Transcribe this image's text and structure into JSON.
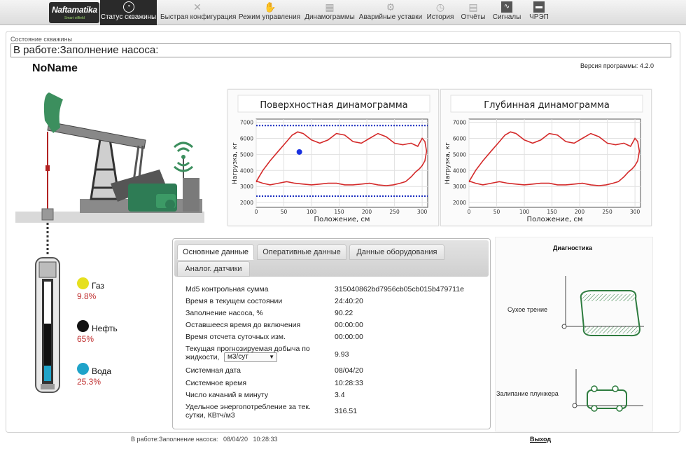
{
  "nav": {
    "logo": {
      "text": "Naftamatika",
      "subtext": "Smart oilfield"
    },
    "tabs": [
      {
        "label": "Статус скважины",
        "icon": "gauge-icon",
        "active": true
      },
      {
        "label": "Быстрая конфигурация",
        "icon": "tools-icon",
        "active": false
      },
      {
        "label": "Режим управления",
        "icon": "hand-icon",
        "active": false
      },
      {
        "label": "Динамограммы",
        "icon": "grid-icon",
        "active": false
      },
      {
        "label": "Аварийные уставки",
        "icon": "gear-icon",
        "active": false
      },
      {
        "label": "История",
        "icon": "clock-icon",
        "active": false
      },
      {
        "label": "Отчёты",
        "icon": "document-icon",
        "active": false
      },
      {
        "label": "Сигналы",
        "icon": "signal-icon",
        "active": false
      },
      {
        "label": "ЧРЭП",
        "icon": "drive-icon",
        "active": false
      }
    ]
  },
  "status": {
    "label": "Состояние скважины",
    "value": "В работе:Заполнение насоса:"
  },
  "well": {
    "name": "NoName",
    "version": "Версия программы: 4.2.0"
  },
  "fluids": {
    "gas": {
      "name": "Газ",
      "value": "9.8%",
      "color": "#e6e01e"
    },
    "oil": {
      "name": "Нефть",
      "value": "65%",
      "color": "#111111"
    },
    "water": {
      "name": "Вода",
      "value": "25.3%",
      "color": "#1fa3c9"
    }
  },
  "chart_data": [
    {
      "type": "line",
      "title": "Поверхностная динамограмма",
      "xlabel": "Положение, см",
      "ylabel": "Нагрузка, кг",
      "xlim": [
        0,
        310
      ],
      "ylim": [
        1700,
        7200
      ],
      "xticks": [
        0,
        50,
        100,
        150,
        200,
        250,
        300
      ],
      "yticks": [
        2000,
        3000,
        4000,
        5000,
        6000,
        7000
      ],
      "grid": true,
      "series": [
        {
          "style": "solid",
          "color": "#d42a2a",
          "x": [
            0,
            12,
            25,
            40,
            55,
            65,
            75,
            85,
            100,
            115,
            130,
            145,
            160,
            175,
            190,
            205,
            220,
            235,
            250,
            265,
            280,
            292,
            300,
            305,
            308,
            305,
            300,
            295,
            288,
            280,
            270,
            260,
            248,
            235,
            220,
            205,
            190,
            175,
            160,
            145,
            130,
            115,
            100,
            85,
            70,
            55,
            40,
            25,
            12,
            3,
            0
          ],
          "y": [
            3300,
            4000,
            4600,
            5200,
            5800,
            6200,
            6400,
            6300,
            5900,
            5700,
            5900,
            6300,
            6200,
            5800,
            5700,
            6000,
            6300,
            6100,
            5700,
            5600,
            5700,
            5500,
            6000,
            5800,
            5200,
            4600,
            4300,
            4100,
            3900,
            3600,
            3300,
            3200,
            3100,
            3050,
            3100,
            3200,
            3150,
            3100,
            3100,
            3200,
            3200,
            3150,
            3100,
            3150,
            3200,
            3300,
            3200,
            3100,
            3200,
            3300,
            3300
          ]
        },
        {
          "style": "dotted",
          "color": "#1c2fbf",
          "x": [
            0,
            310
          ],
          "y": [
            6800,
            6800
          ]
        },
        {
          "style": "dotted",
          "color": "#1c2fbf",
          "x": [
            0,
            310
          ],
          "y": [
            2400,
            2400
          ]
        },
        {
          "style": "point",
          "color": "#1a32e0",
          "x": [
            78
          ],
          "y": [
            5150
          ]
        }
      ]
    },
    {
      "type": "line",
      "title": "Глубинная динамограмма",
      "xlabel": "Положение, см",
      "ylabel": "Нагрузка, кг",
      "xlim": [
        0,
        310
      ],
      "ylim": [
        1700,
        7200
      ],
      "xticks": [
        0,
        50,
        100,
        150,
        200,
        250,
        300
      ],
      "yticks": [
        2000,
        3000,
        4000,
        5000,
        6000,
        7000
      ],
      "grid": true,
      "series": [
        {
          "style": "solid",
          "color": "#d42a2a",
          "x": [
            0,
            12,
            25,
            40,
            55,
            65,
            75,
            85,
            100,
            115,
            130,
            145,
            160,
            175,
            190,
            205,
            220,
            235,
            250,
            265,
            280,
            292,
            300,
            305,
            308,
            305,
            300,
            295,
            288,
            280,
            270,
            260,
            248,
            235,
            220,
            205,
            190,
            175,
            160,
            145,
            130,
            115,
            100,
            85,
            70,
            55,
            40,
            25,
            12,
            3,
            0
          ],
          "y": [
            3300,
            4000,
            4600,
            5200,
            5800,
            6200,
            6400,
            6300,
            5900,
            5700,
            5900,
            6300,
            6200,
            5800,
            5700,
            6000,
            6300,
            6100,
            5700,
            5600,
            5700,
            5500,
            6000,
            5800,
            5200,
            4600,
            4300,
            4100,
            3900,
            3600,
            3300,
            3200,
            3100,
            3050,
            3100,
            3200,
            3150,
            3100,
            3100,
            3200,
            3200,
            3150,
            3100,
            3150,
            3200,
            3300,
            3200,
            3100,
            3200,
            3300,
            3300
          ]
        }
      ]
    }
  ],
  "tabs": [
    {
      "label": "Основные данные",
      "selected": true
    },
    {
      "label": "Оперативные данные",
      "selected": false
    },
    {
      "label": "Данные оборудования",
      "selected": false
    },
    {
      "label": "Аналог. датчики",
      "selected": false
    }
  ],
  "data_rows": [
    {
      "label": "Md5 контрольная сумма",
      "value": "315040862bd7956cb05cb015b479711e"
    },
    {
      "label": "Время в текущем состоянии",
      "value": "24:40:20"
    },
    {
      "label": "Заполнение насоса, %",
      "value": "90.22"
    },
    {
      "label": "Оставшееся время до включения",
      "value": "00:00:00"
    },
    {
      "label": "Время отсчета суточных изм.",
      "value": "00:00:00"
    },
    {
      "label": "Текущая прогнозируемая добыча по жидкости,",
      "value": "9.93"
    },
    {
      "label": "Системная дата",
      "value": "08/04/20"
    },
    {
      "label": "Системное время",
      "value": "10:28:33"
    },
    {
      "label": "Число качаний в минуту",
      "value": "3.4"
    },
    {
      "label": "Удельное энергопотребление за тек. сутки, КВтч/м3",
      "value": "316.51"
    }
  ],
  "unit_select": {
    "value": "м3/сут"
  },
  "diagnostics": {
    "title": "Диагностика",
    "items": [
      {
        "label": "Сухое трение"
      },
      {
        "label": "Залипание плунжера"
      }
    ]
  },
  "footer": {
    "state": "В работе:Заполнение насоса:",
    "date": "08/04/20",
    "time": "10:28:33",
    "logout": "Выход"
  }
}
